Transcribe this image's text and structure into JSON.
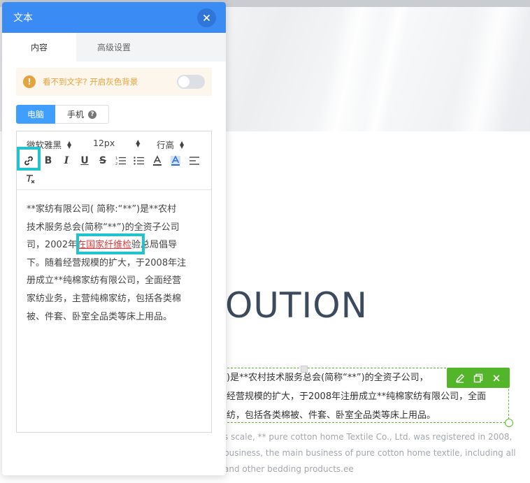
{
  "panel": {
    "title": "文本",
    "tabs": [
      {
        "label": "内容",
        "active": true
      },
      {
        "label": "高级设置",
        "active": false
      }
    ],
    "notice": {
      "text": "看不到文字? 开启灰色背景",
      "icon": "!",
      "toggle_on": false
    },
    "device": {
      "desktop": "电脑",
      "mobile": "手机",
      "help_icon": "?"
    },
    "toolbar": {
      "font_family": "微软雅黑",
      "font_size": "12px",
      "line_height": "行高"
    },
    "content_lines": [
      {
        "text": "**家纺有限公司( 简称:“**”)是**农村"
      },
      {
        "text": "技术服务总会(简称“**”)的全资子公司"
      },
      {
        "prefix": "司，2002年",
        "link": "在国家纤维检",
        "suffix": "验总局倡导"
      },
      {
        "text": "下。随着经营规模的扩大，于2008年注"
      },
      {
        "text": "册成立**纯棉家纺有限公司，全面经营"
      },
      {
        "text": "家纺业务，主营纯棉家纺，包括各类棉"
      },
      {
        "text": "被、件套、卧室全品类等床上用品。"
      }
    ]
  },
  "page": {
    "heading": "OUTION",
    "cn_lines": [
      ")是**农村技术服务总会(简称“**”)的全资子公司，",
      "经营规模的扩大，于2008年注册成立**纯棉家纺有限公司，全面",
      "纺，包括各类棉被、件套、卧室全品类等床上用品。"
    ],
    "en_lines": [
      "s scale, ** pure cotton home Textile Co., Ltd. was registered in 2008,",
      "business, the main business of pure cotton home textile, including all",
      "and other bedding products.ee"
    ]
  },
  "colors": {
    "header": "#3b8bf5",
    "accent_blue": "#409eff",
    "notice_bg": "#fdf6ec",
    "notice_text": "#e6a23c",
    "link": "#e03b3b",
    "highlight": "#22c3cd",
    "selection_green": "#53b52a"
  },
  "icons": {
    "close": "close-icon",
    "link": "link-icon",
    "bold": "bold-icon",
    "italic": "italic-icon",
    "underline": "underline-icon",
    "strike": "strikethrough-icon",
    "ordered_list": "ordered-list-icon",
    "bullet_list": "bullet-list-icon",
    "font_color": "font-color-icon",
    "bg_color": "background-color-icon",
    "align": "align-icon",
    "clear_format": "clear-format-icon",
    "edit": "pencil-icon",
    "copy": "copy-icon",
    "delete": "close-icon"
  }
}
